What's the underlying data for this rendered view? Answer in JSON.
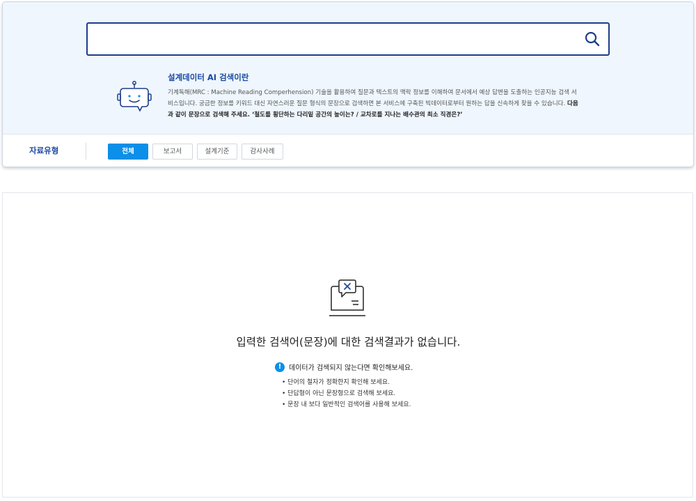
{
  "search": {
    "value": "",
    "placeholder": "",
    "button_icon": "search-icon"
  },
  "intro": {
    "icon": "chatbot-icon",
    "title": "설계데이터 AI 검색이란",
    "desc_normal": "기계독해(MRC : Machine Reading Comperhension) 기술을 활용하여 질문과 텍스트의 맥락 정보를 이해하여 문서에서 예상 답변을 도출하는 인공지능 검색 서비스입니다. 궁금한 정보를 키워드 대신 자연스러운 질문 형식의 문장으로 검색하면 본 서비스에 구축된 빅데이터로부터 원하는 답을 신속하게 찾을 수 있습니다. ",
    "desc_bold": "다음과 같이 문장으로 검색해 주세요. ‘철도를 횡단하는 다리밑 공간의 높이는? / 교차로를 지나는 배수관의 최소 직경은?’"
  },
  "type_filter": {
    "label": "자료유형",
    "tabs": [
      {
        "label": "전체",
        "active": true
      },
      {
        "label": "보고서",
        "active": false
      },
      {
        "label": "설계기준",
        "active": false
      },
      {
        "label": "감사사례",
        "active": false
      }
    ]
  },
  "result": {
    "empty_icon": "no-result-icon",
    "empty_title": "입력한 검색어(문장)에 대한 검색결과가 없습니다.",
    "notice_icon": "!",
    "notice": "데이터가 검색되지 않는다면 확인해보세요.",
    "tips": [
      "단어의 철자가 정확한지 확인해 보세요.",
      "단답형이 아닌 문장형으로 검색해 보세요.",
      "문장 내 보다 일반적인 검색어를 사용해 보세요."
    ]
  },
  "colors": {
    "accent": "#0b8fe8",
    "brand_navy": "#1c4aa4",
    "panel_bg": "#eff6fd"
  }
}
